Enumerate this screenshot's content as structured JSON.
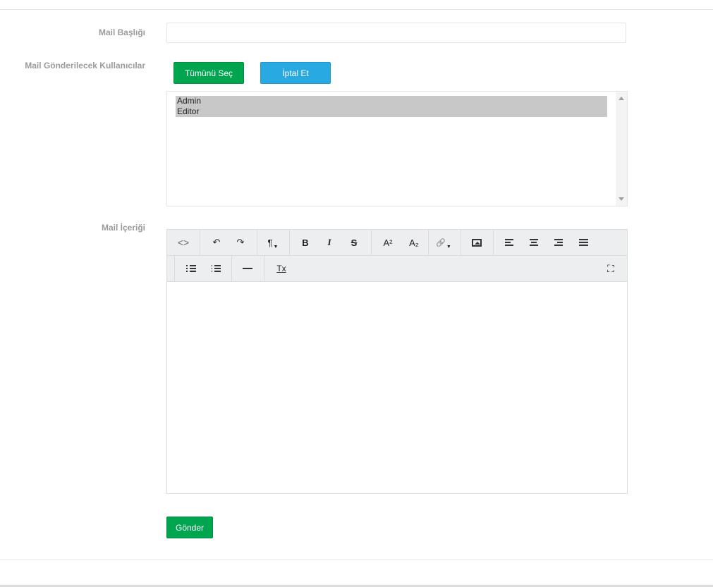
{
  "form": {
    "title_label": "Mail Başlığı",
    "title_value": "",
    "users_label": "Mail Gönderilecek Kullanıcılar",
    "select_all_label": "Tümünü Seç",
    "cancel_label": "İptal Et",
    "users": [
      "Admin",
      "Editor"
    ],
    "content_label": "Mail İçeriği",
    "send_label": "Gönder"
  },
  "editor": {
    "toolbar": {
      "code": "<>",
      "undo": "↶",
      "redo": "↷",
      "paragraph": "¶",
      "bold": "B",
      "italic": "I",
      "strike": "S",
      "superscript": "A²",
      "subscript": "A₂",
      "link": "🔗",
      "clear_format": "Tx",
      "fullscreen": "⛶"
    },
    "icons": [
      "code-icon",
      "undo-icon",
      "redo-icon",
      "paragraph-icon",
      "bold-icon",
      "italic-icon",
      "strikethrough-icon",
      "superscript-icon",
      "subscript-icon",
      "link-icon",
      "image-icon",
      "align-left-icon",
      "align-center-icon",
      "align-right-icon",
      "align-justify-icon",
      "unordered-list-icon",
      "ordered-list-icon",
      "horizontal-rule-icon",
      "clear-format-icon",
      "fullscreen-icon"
    ]
  },
  "colors": {
    "success": "#00a550",
    "info": "#29a9e1",
    "label": "#9a9a9a",
    "toolbar_bg": "#eceeef"
  }
}
